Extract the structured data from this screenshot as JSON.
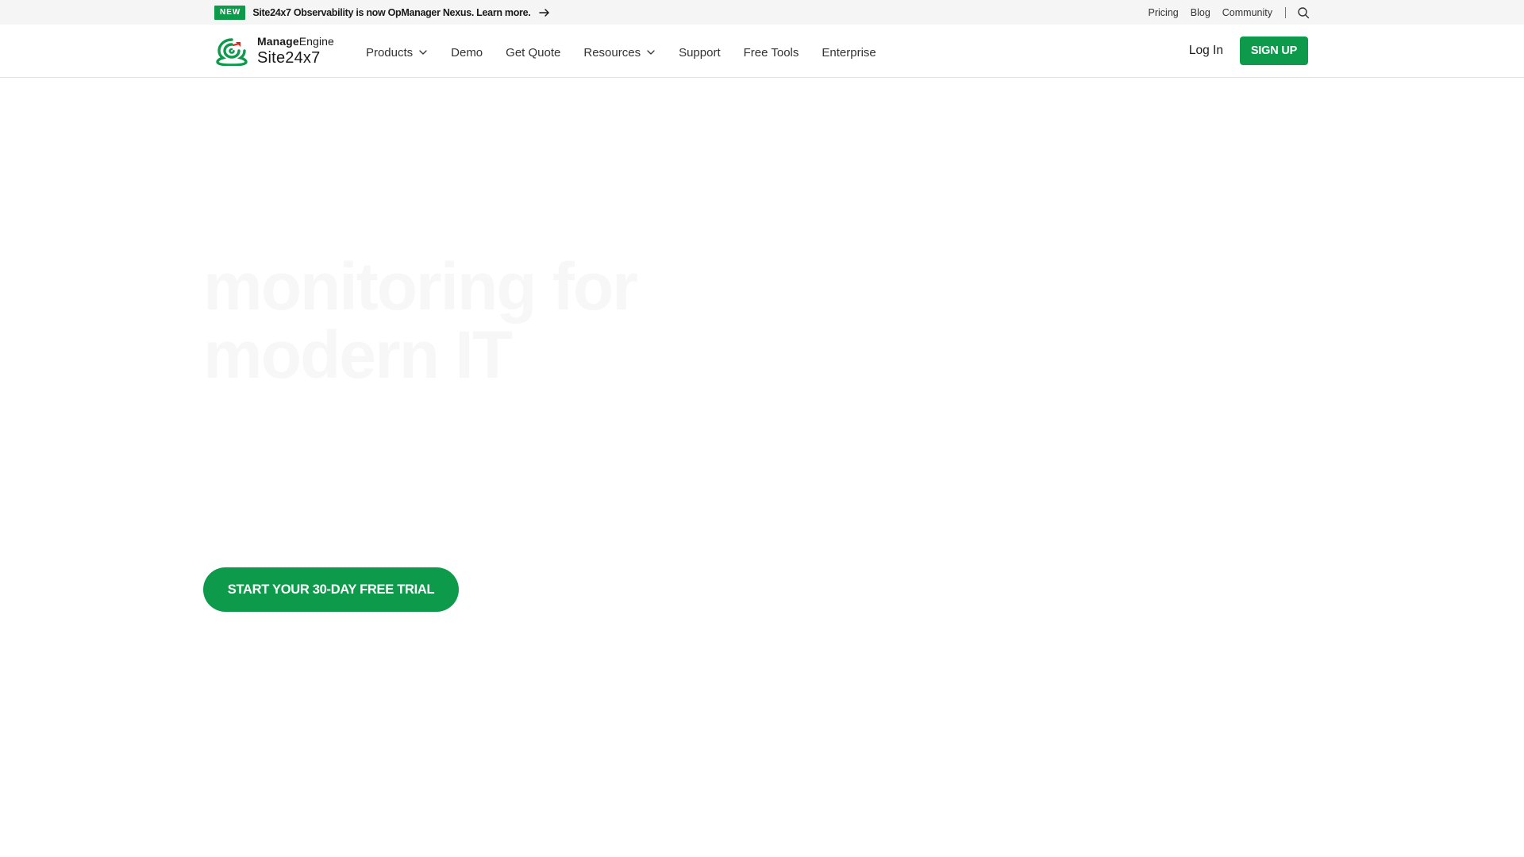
{
  "announcement": {
    "badge": "NEW",
    "text": "Site24x7 Observability is now OpManager Nexus. Learn more.",
    "arrow_icon": "arrow-right-icon"
  },
  "utility_nav": {
    "links": [
      "Pricing",
      "Blog",
      "Community"
    ],
    "search_icon": "search-icon"
  },
  "brand": {
    "company_bold": "Manage",
    "company_rest": "Engine",
    "product": "Site24x7",
    "logo_icon": "site24x7-logo-icon"
  },
  "main_nav": {
    "items": [
      {
        "label": "Products",
        "dropdown": true
      },
      {
        "label": "Demo",
        "dropdown": false
      },
      {
        "label": "Get Quote",
        "dropdown": false
      },
      {
        "label": "Resources",
        "dropdown": true
      },
      {
        "label": "Support",
        "dropdown": false
      },
      {
        "label": "Free Tools",
        "dropdown": false
      },
      {
        "label": "Enterprise",
        "dropdown": false
      }
    ],
    "login_label": "Log In",
    "signup_label": "SIGN UP"
  },
  "hero": {
    "title_line1": "monitoring for",
    "title_line2": "modern IT",
    "cta_label": "START YOUR 30-DAY FREE TRIAL"
  },
  "colors": {
    "brand_green": "#0d9a4b",
    "topbar_bg": "#f5f5f5",
    "logo_red": "#e2231a",
    "hero_title_faded": "#f7f7f7"
  }
}
